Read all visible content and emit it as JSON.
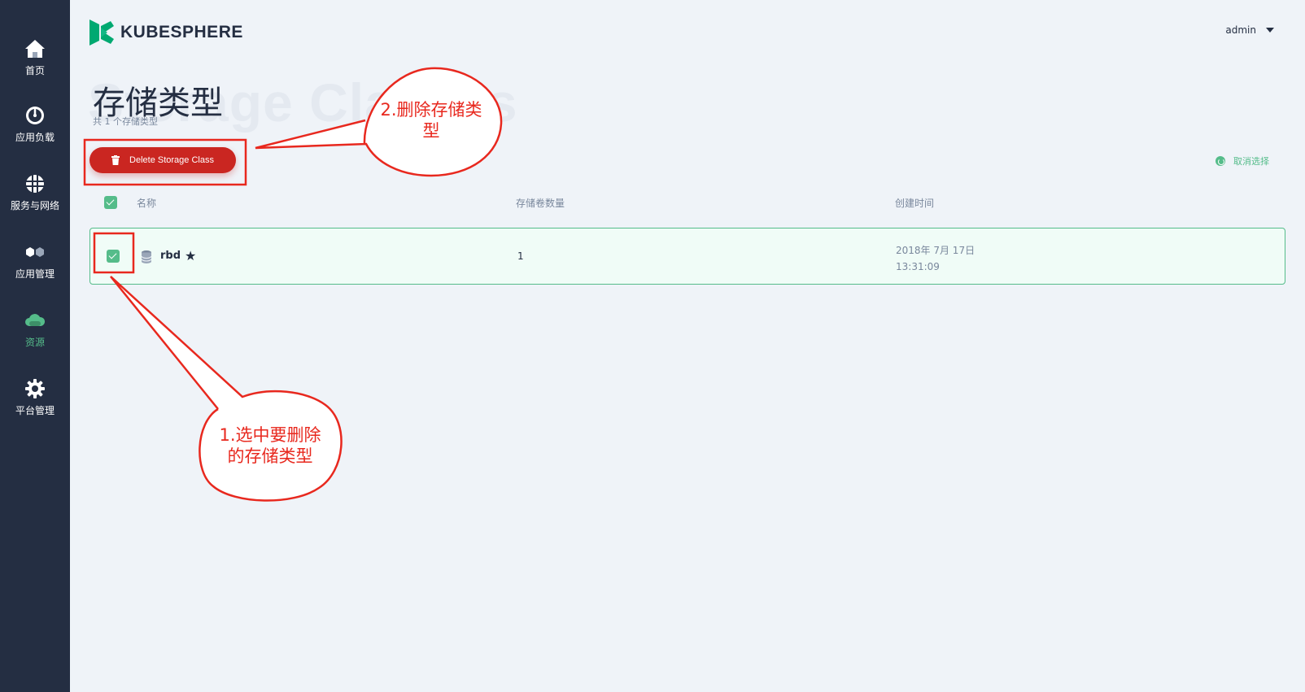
{
  "sidebar": {
    "items": [
      {
        "label": "首页",
        "icon": "home-icon"
      },
      {
        "label": "应用负载",
        "icon": "dashboard-gauge-icon"
      },
      {
        "label": "服务与网络",
        "icon": "globe-network-icon"
      },
      {
        "label": "应用管理",
        "icon": "hexagon-apps-icon"
      },
      {
        "label": "资源",
        "icon": "cloud-icon",
        "active": true
      },
      {
        "label": "平台管理",
        "icon": "gear-icon"
      }
    ]
  },
  "header": {
    "logo_text": "KUBESPHERE",
    "user": "admin"
  },
  "page": {
    "bg_title": "Storage Classes",
    "title": "存储类型",
    "subtitle": "共 1 个存储类型"
  },
  "toolbar": {
    "delete_label": "Delete Storage Class",
    "clear_selection_label": "取消选择"
  },
  "table": {
    "columns": [
      "名称",
      "存储卷数量",
      "创建时间"
    ],
    "rows": [
      {
        "name": "rbd",
        "default": true,
        "volume_count": "1",
        "created_date": "2018年 7月 17日",
        "created_time": "13:31:09",
        "selected": true
      }
    ]
  },
  "annotations": {
    "callout_1_line1": "1.选中要删除",
    "callout_1_line2": "的存储类型",
    "callout_2_line1": "2.删除存储类",
    "callout_2_line2": "型"
  },
  "colors": {
    "sidebar_bg": "#242e42",
    "accent_green": "#55bc8a",
    "danger_red": "#ca2621",
    "annotation_red": "#e8281e"
  }
}
